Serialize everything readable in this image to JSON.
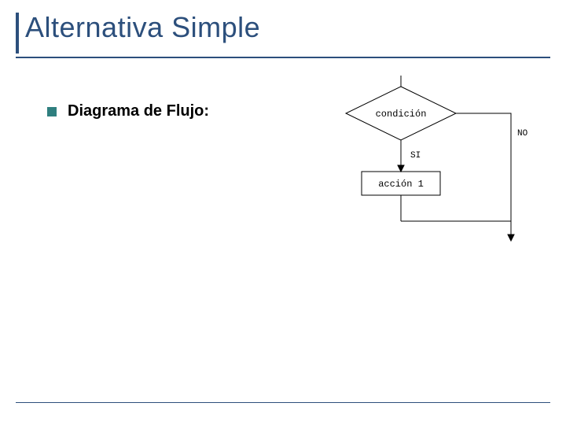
{
  "title": "Alternativa Simple",
  "bullet": {
    "label": "Diagrama de Flujo:"
  },
  "flowchart": {
    "condition": "condición",
    "yes_label": "SI",
    "no_label": "NO",
    "action": "acción 1"
  }
}
